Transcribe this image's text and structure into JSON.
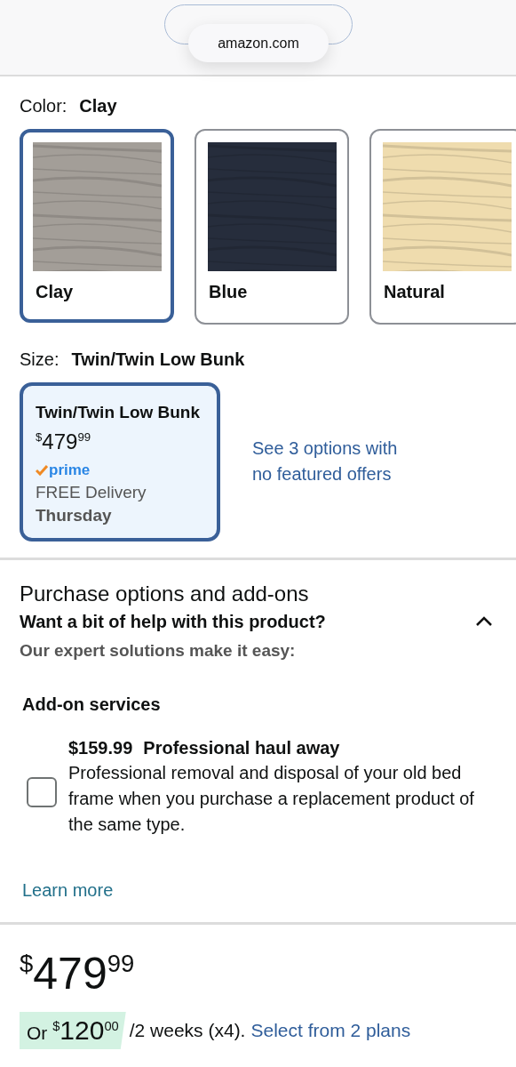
{
  "url_pill": {
    "text": "amazon.com"
  },
  "color": {
    "label": "Color:",
    "value": "Clay",
    "options": [
      {
        "name": "Clay",
        "color": "#a39e98",
        "selected": true
      },
      {
        "name": "Blue",
        "color": "#262d3c",
        "selected": false
      },
      {
        "name": "Natural",
        "color": "#efdcae",
        "selected": false
      }
    ]
  },
  "size": {
    "label": "Size:",
    "value": "Twin/Twin Low Bunk",
    "options": [
      {
        "name": "Twin/Twin Low Bunk",
        "price": {
          "symbol": "$",
          "whole": "479",
          "fraction": "99"
        },
        "prime": "prime",
        "delivery": "FREE Delivery",
        "day": "Thursday",
        "selected": true
      }
    ],
    "more_link": "See 3 options with no featured offers"
  },
  "purchase": {
    "title": "Purchase options and add-ons",
    "subtitle": "Want a bit of help with this product?",
    "expanded": true,
    "note": "Our expert solutions make it easy:",
    "addons_heading": "Add-on services",
    "services": [
      {
        "price": "$159.99",
        "title": "Professional haul away",
        "description": "Professional removal and disposal of your old bed frame when you purchase a replacement product of the same type.",
        "checked": false
      }
    ],
    "learn_more": "Learn more"
  },
  "buybox": {
    "price": {
      "symbol": "$",
      "whole": "479",
      "fraction": "99"
    },
    "installment": {
      "prefix": "Or ",
      "symbol": "$",
      "whole": "120",
      "fraction": "00",
      "suffix": "/2 weeks (x4).",
      "link": "Select from 2 plans"
    }
  }
}
